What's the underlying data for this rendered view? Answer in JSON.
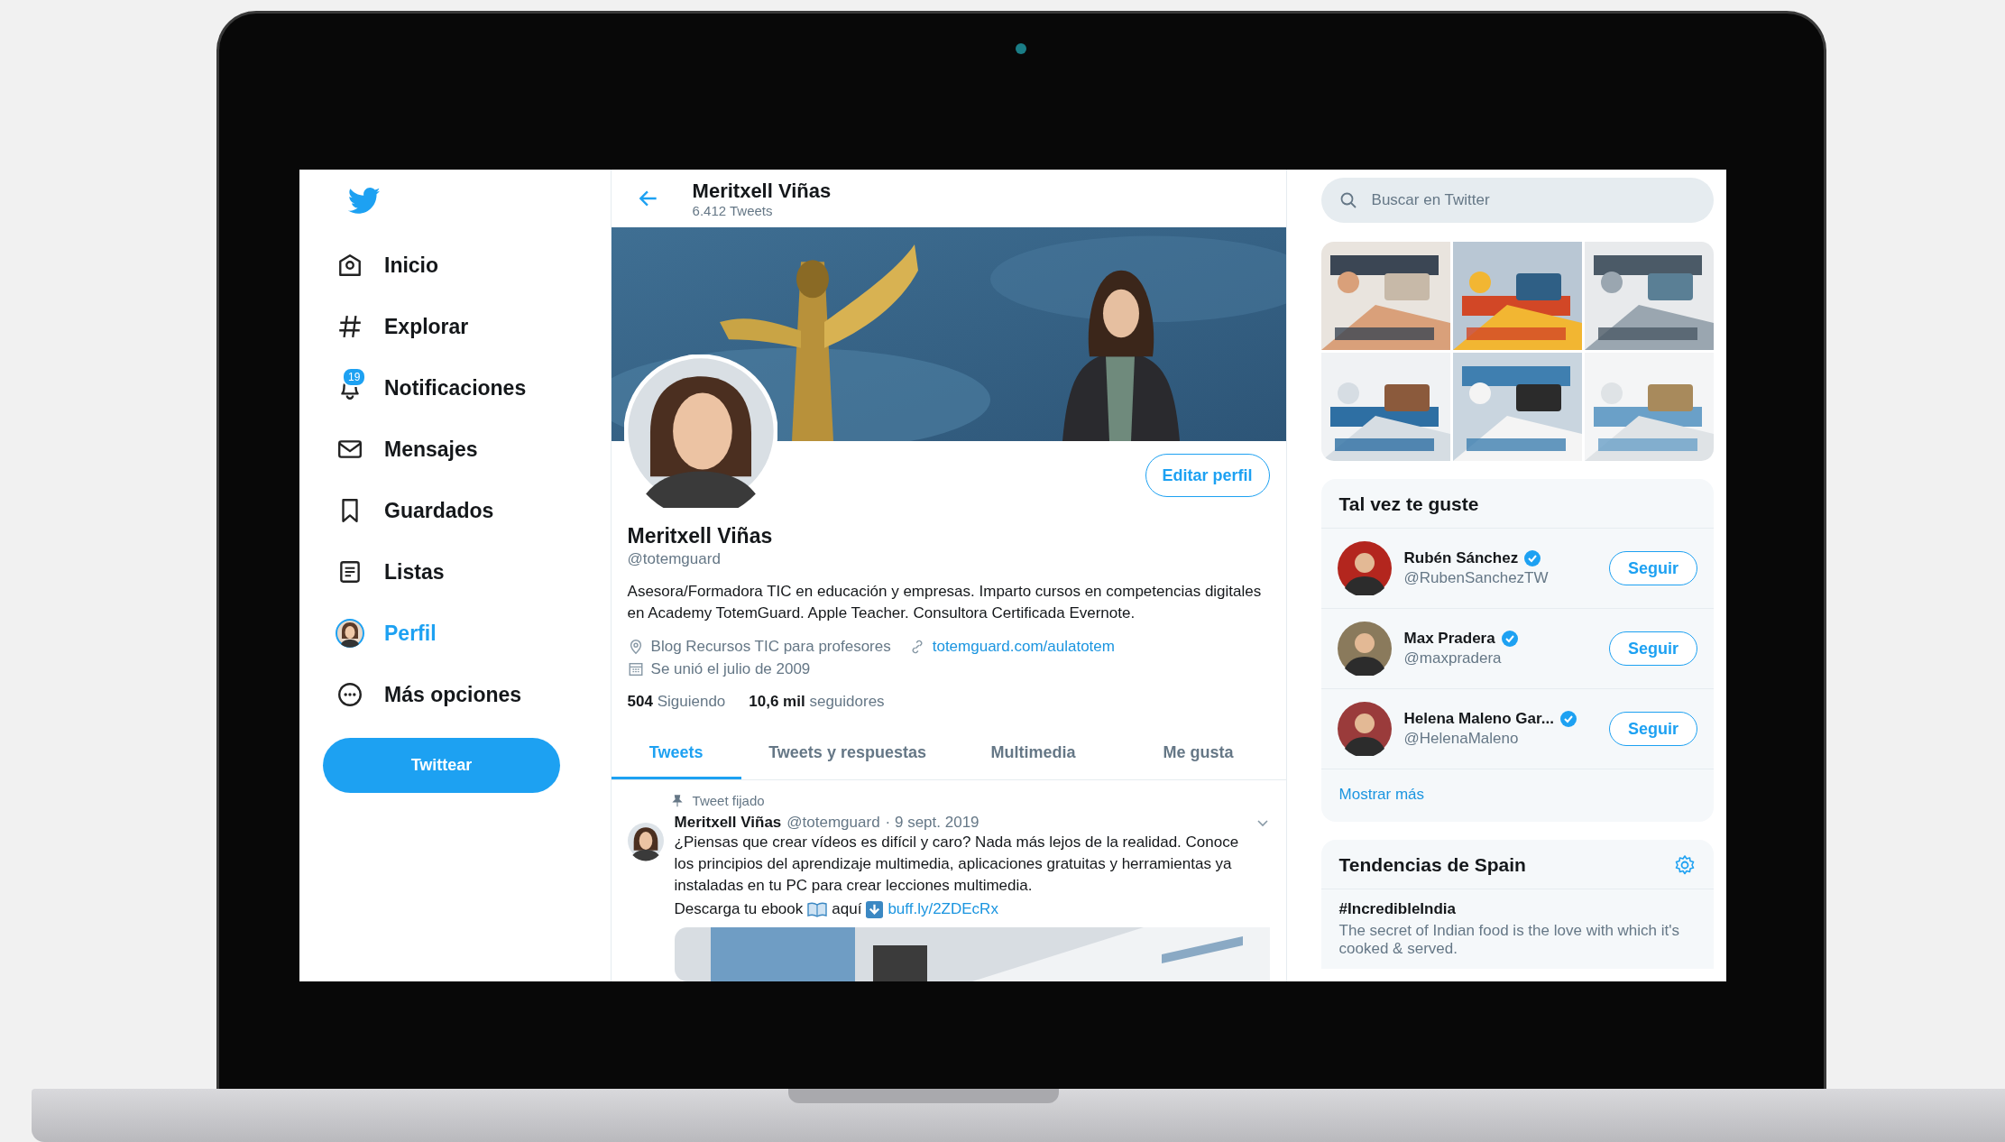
{
  "sidebar": {
    "items": [
      {
        "label": "Inicio",
        "kind": "home",
        "selected": false
      },
      {
        "label": "Explorar",
        "kind": "hash",
        "selected": false
      },
      {
        "label": "Notificaciones",
        "kind": "bell",
        "badge": "19",
        "selected": false
      },
      {
        "label": "Mensajes",
        "kind": "mail",
        "selected": false
      },
      {
        "label": "Guardados",
        "kind": "bookmark",
        "selected": false
      },
      {
        "label": "Listas",
        "kind": "list",
        "selected": false
      },
      {
        "label": "Perfil",
        "kind": "avatar",
        "selected": true
      },
      {
        "label": "Más opciones",
        "kind": "more",
        "selected": false
      }
    ],
    "tweet_button": "Twittear"
  },
  "header": {
    "title": "Meritxell Viñas",
    "subtitle": "6.412 Tweets"
  },
  "profile": {
    "edit_button": "Editar perfil",
    "name": "Meritxell Viñas",
    "handle": "@totemguard",
    "bio": "Asesora/Formadora TIC en educación y empresas. Imparto cursos en competencias digitales en Academy TotemGuard. Apple Teacher. Consultora Certificada Evernote.",
    "location": "Blog Recursos TIC para profesores",
    "website": "totemguard.com/aulatotem",
    "joined": "Se unió el julio de 2009",
    "following_count": "504",
    "following_label": "Siguiendo",
    "followers_count": "10,6 mil",
    "followers_label": "seguidores"
  },
  "tabs": [
    {
      "label": "Tweets",
      "selected": true
    },
    {
      "label": "Tweets y respuestas",
      "selected": false
    },
    {
      "label": "Multimedia",
      "selected": false
    },
    {
      "label": "Me gusta",
      "selected": false
    }
  ],
  "pinned_tweet": {
    "pinned_label": "Tweet fijado",
    "author": "Meritxell Viñas",
    "handle": "@totemguard",
    "date": "· 9 sept. 2019",
    "text": "¿Piensas que crear vídeos es difícil y caro? Nada más lejos de la realidad. Conoce los principios del aprendizaje multimedia, aplicaciones gratuitas y herramientas ya instaladas en tu PC para crear lecciones multimedia.",
    "text_before_icon": "Descarga tu ebook",
    "text_after_icon": "aquí",
    "link": "buff.ly/2ZDEcRx"
  },
  "search": {
    "placeholder": "Buscar en Twitter"
  },
  "who_to_follow": {
    "title": "Tal vez te guste",
    "users": [
      {
        "name": "Rubén Sánchez",
        "handle": "@RubenSanchezTW",
        "verified": true,
        "button": "Seguir"
      },
      {
        "name": "Max Pradera",
        "handle": "@maxpradera",
        "verified": true,
        "button": "Seguir"
      },
      {
        "name": "Helena Maleno Gar...",
        "handle": "@HelenaMaleno",
        "verified": true,
        "button": "Seguir"
      }
    ],
    "show_more": "Mostrar más"
  },
  "trends": {
    "title": "Tendencias de Spain",
    "items": [
      {
        "name": "#IncredibleIndia",
        "description": "The secret of Indian food is the love with which it's cooked & served."
      }
    ]
  }
}
